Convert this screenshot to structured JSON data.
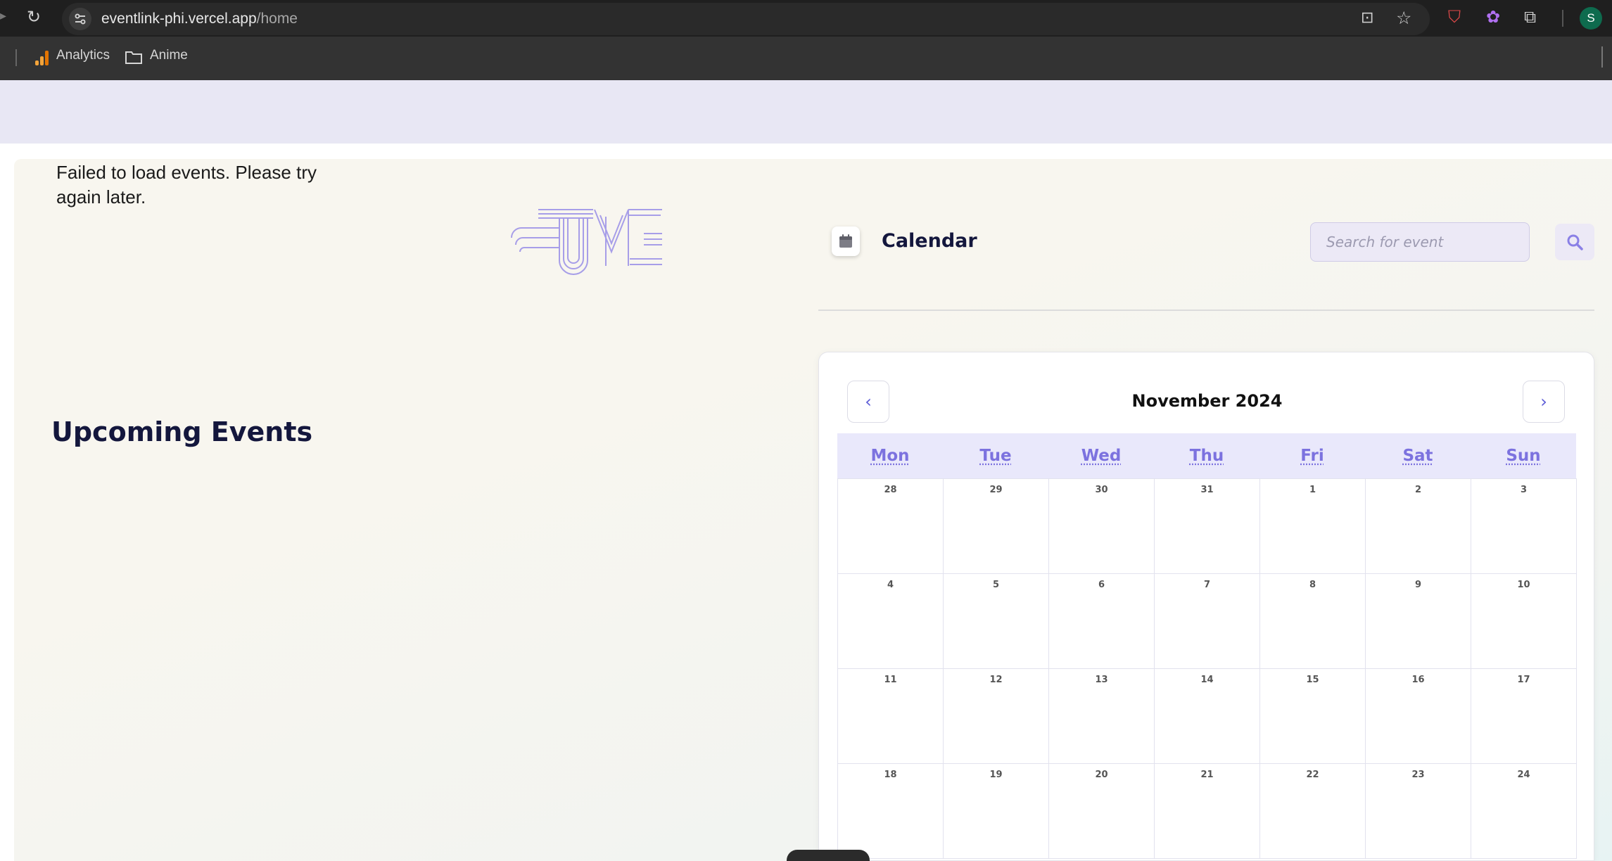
{
  "browser": {
    "url_host": "eventlink-phi.vercel.app",
    "url_path": "/home",
    "profile_initial": "S",
    "bookmarks": [
      {
        "label": "Analytics",
        "icon": "analytics-icon"
      },
      {
        "label": "Anime",
        "icon": "folder-icon"
      }
    ]
  },
  "page": {
    "error_message": "Failed to load events. Please try again later.",
    "logo_text": "UM",
    "upcoming_title": "Upcoming Events"
  },
  "calendar": {
    "heading": "Calendar",
    "search_placeholder": "Search for event",
    "month_label": "November 2024",
    "prev_label": "‹",
    "next_label": "›",
    "weekdays": [
      "Mon",
      "Tue",
      "Wed",
      "Thu",
      "Fri",
      "Sat",
      "Sun"
    ],
    "weeks": [
      [
        "28",
        "29",
        "30",
        "31",
        "1",
        "2",
        "3"
      ],
      [
        "4",
        "5",
        "6",
        "7",
        "8",
        "9",
        "10"
      ],
      [
        "11",
        "12",
        "13",
        "14",
        "15",
        "16",
        "17"
      ],
      [
        "18",
        "19",
        "20",
        "21",
        "22",
        "23",
        "24"
      ]
    ]
  },
  "colors": {
    "accent": "#7c72df",
    "title": "#14173d",
    "header_bg": "#e8e7f4"
  }
}
